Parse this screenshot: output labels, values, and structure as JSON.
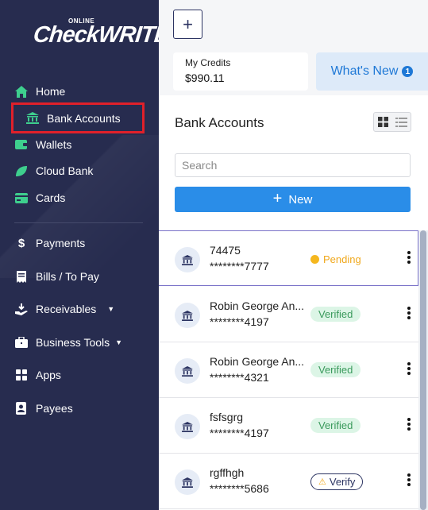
{
  "logo": {
    "small": "ONLINE",
    "big": "CheckWRITER"
  },
  "sidebar": {
    "items": [
      {
        "label": "Home",
        "icon": "home-icon"
      },
      {
        "label": "Bank Accounts",
        "icon": "bank-icon",
        "active": true
      },
      {
        "label": "Wallets",
        "icon": "wallet-icon"
      },
      {
        "label": "Cloud Bank",
        "icon": "leaf-icon"
      },
      {
        "label": "Cards",
        "icon": "card-icon"
      },
      {
        "label": "Payments",
        "icon": "dollar-icon"
      },
      {
        "label": "Bills / To Pay",
        "icon": "bill-icon"
      },
      {
        "label": "Receivables",
        "icon": "receive-icon",
        "dropdown": true
      },
      {
        "label": "Business Tools",
        "icon": "briefcase-icon",
        "dropdown": true
      },
      {
        "label": "Apps",
        "icon": "apps-grid-icon"
      },
      {
        "label": "Payees",
        "icon": "payee-icon"
      }
    ]
  },
  "header": {
    "add_button": "+",
    "credits_label": "My Credits",
    "credits_value": "$990.11",
    "whats_new_label": "What's New",
    "whats_new_count": "1"
  },
  "panel": {
    "title": "Bank Accounts",
    "search_placeholder": "Search",
    "new_button": "New",
    "accounts": [
      {
        "name": "74475",
        "number": "********7777",
        "status": "Pending",
        "status_type": "pending"
      },
      {
        "name": "Robin George An...",
        "number": "********4197",
        "status": "Verified",
        "status_type": "verified"
      },
      {
        "name": "Robin George An...",
        "number": "********4321",
        "status": "Verified",
        "status_type": "verified"
      },
      {
        "name": "fsfsgrg",
        "number": "********4197",
        "status": "Verified",
        "status_type": "verified"
      },
      {
        "name": "rgffhgh",
        "number": "********5686",
        "status": "Verify",
        "status_type": "verify"
      }
    ]
  },
  "colors": {
    "sidebar_bg": "#272c4f",
    "accent_green": "#3ecf8e",
    "primary_blue": "#2a8de8",
    "active_border": "#e0202a"
  }
}
